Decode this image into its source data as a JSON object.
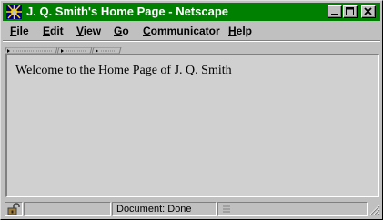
{
  "window": {
    "title": "J. Q. Smith's Home Page - Netscape",
    "titlebar_color": "#008000"
  },
  "title_buttons": [
    {
      "icon": "minimize-icon"
    },
    {
      "icon": "maximize-icon"
    },
    {
      "icon": "close-icon"
    }
  ],
  "menu": {
    "file": {
      "first": "F",
      "rest": "ile"
    },
    "edit": {
      "first": "E",
      "rest": "dit"
    },
    "view": {
      "first": "V",
      "rest": "iew"
    },
    "go": {
      "first": "G",
      "rest": "o"
    },
    "communicator": {
      "first": "C",
      "rest": "ommunicator"
    },
    "help": {
      "first": "H",
      "rest": "elp"
    }
  },
  "page": {
    "welcome_text": "Welcome to the Home Page of J. Q. Smith",
    "background": "#d0d0d0"
  },
  "status": {
    "text": "Document: Done",
    "security_icon": "unlocked-padlock-icon"
  }
}
